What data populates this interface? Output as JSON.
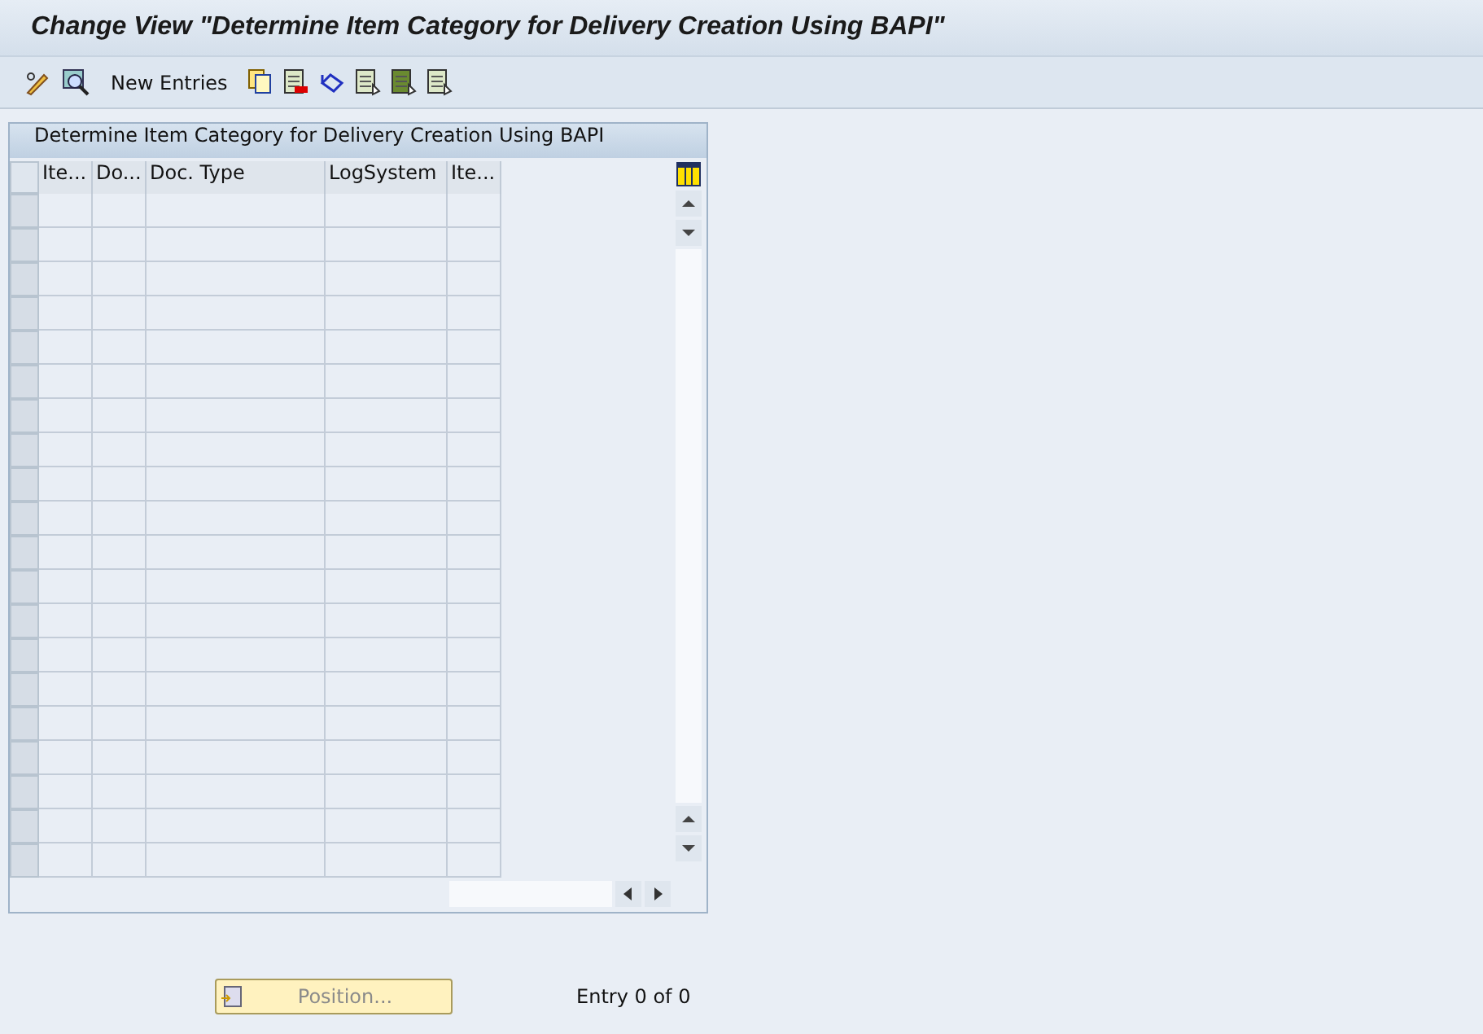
{
  "window": {
    "title": "Change View \"Determine Item Category for Delivery Creation Using BAPI\""
  },
  "toolbar": {
    "new_entries": "New Entries"
  },
  "table": {
    "title": "Determine Item Category for Delivery Creation Using BAPI",
    "columns": [
      "Ite...",
      "Do...",
      "Doc. Type",
      "LogSystem",
      "Ite..."
    ]
  },
  "footer": {
    "position_button": {
      "label": "Position...",
      "disabled": true
    },
    "entry_count": "Entry 0 of 0"
  }
}
